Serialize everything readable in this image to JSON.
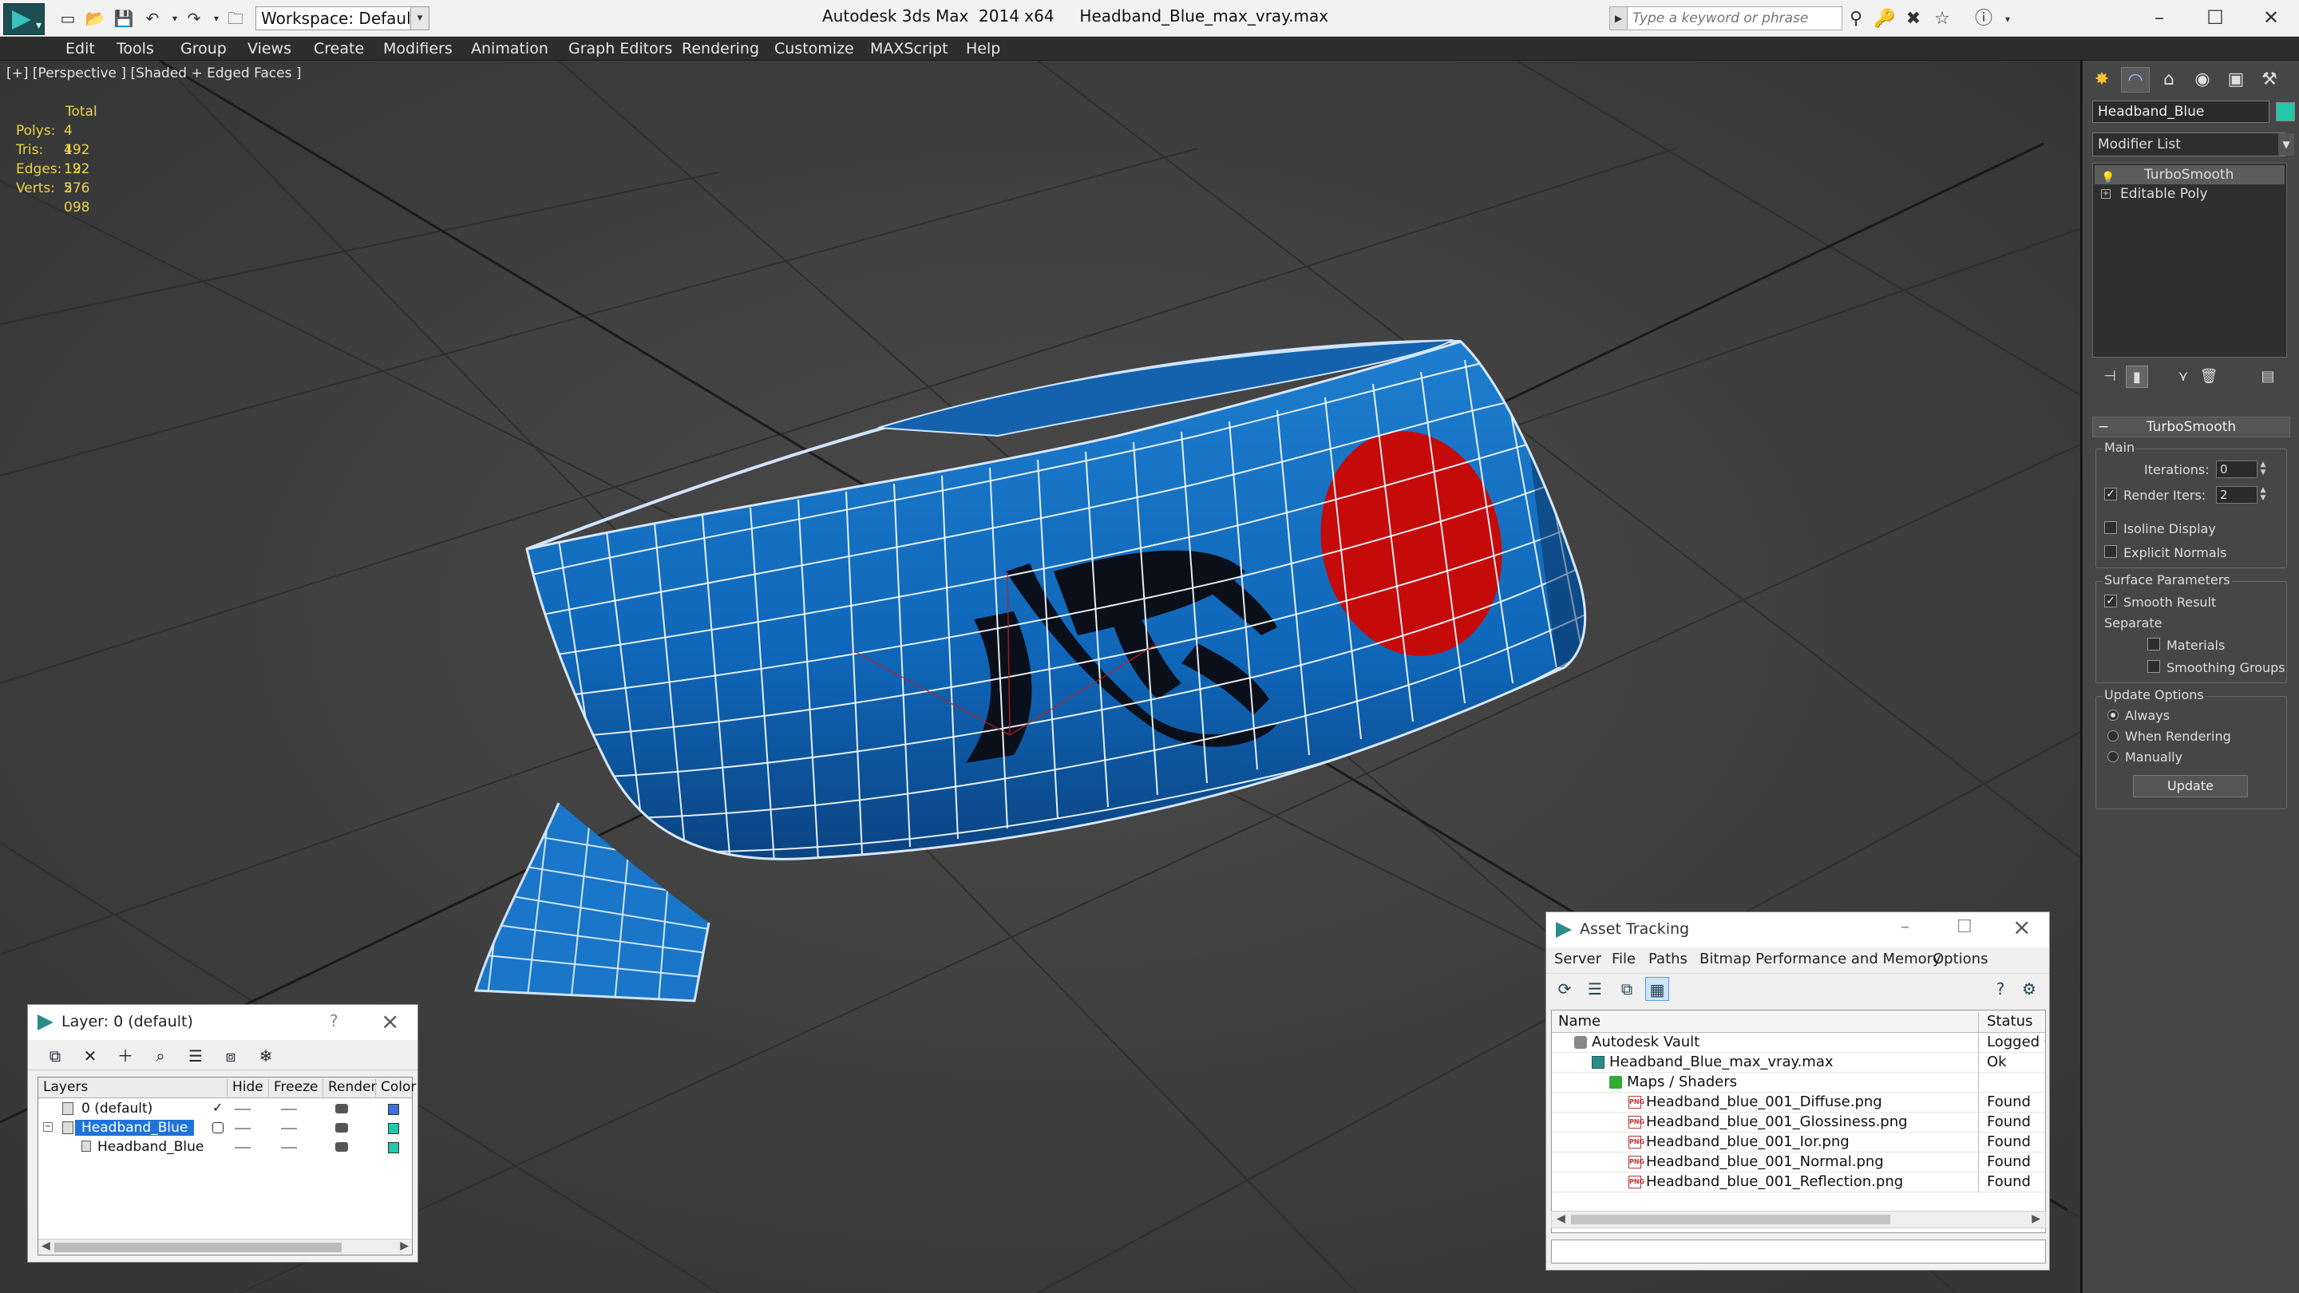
{
  "titlebar": {
    "workspace": "Workspace: Default",
    "app_name": "Autodesk 3ds Max  2014 x64",
    "file_name": "Headband_Blue_max_vray.max",
    "search_placeholder": "Type a keyword or phrase"
  },
  "menu": [
    "Edit",
    "Tools",
    "Group",
    "Views",
    "Create",
    "Modifiers",
    "Animation",
    "Graph Editors",
    "Rendering",
    "Customize",
    "MAXScript",
    "Help"
  ],
  "viewport": {
    "label": "[+] [Perspective ] [Shaded + Edged Faces ]",
    "stats": {
      "header": "Total",
      "rows": [
        {
          "key": "Polys:",
          "value": "4 192"
        },
        {
          "key": "Tris:",
          "value": "4 192"
        },
        {
          "key": "Edges:",
          "value": "12 576"
        },
        {
          "key": "Verts:",
          "value": "2 098"
        }
      ]
    }
  },
  "layer_dialog": {
    "title": "Layer: 0 (default)",
    "help": "?",
    "columns": [
      "Layers",
      "Hide",
      "Freeze",
      "Render",
      "Color"
    ],
    "rows": [
      {
        "name": "0 (default)",
        "color": "#3a6fd8"
      },
      {
        "name": "Headband_Blue",
        "color": "#22c8a8"
      },
      {
        "name": "Headband_Blue",
        "color": "#22c8a8"
      }
    ]
  },
  "asset_dialog": {
    "title": "Asset Tracking",
    "menu": [
      "Server",
      "File",
      "Paths",
      "Bitmap Performance and Memory",
      "Options"
    ],
    "columns": [
      "Name",
      "Status"
    ],
    "rows": [
      {
        "name": "Autodesk Vault",
        "status": "Logged Ou"
      },
      {
        "name": "Headband_Blue_max_vray.max",
        "status": "Ok"
      },
      {
        "name": "Maps / Shaders",
        "status": ""
      },
      {
        "name": "Headband_blue_001_Diffuse.png",
        "status": "Found"
      },
      {
        "name": "Headband_blue_001_Glossiness.png",
        "status": "Found"
      },
      {
        "name": "Headband_blue_001_Ior.png",
        "status": "Found"
      },
      {
        "name": "Headband_blue_001_Normal.png",
        "status": "Found"
      },
      {
        "name": "Headband_blue_001_Reflection.png",
        "status": "Found"
      }
    ]
  },
  "command_panel": {
    "object_name": "Headband_Blue",
    "object_color": "#22c8a8",
    "modifier_list": "Modifier List",
    "stack": [
      "TurboSmooth",
      "Editable Poly"
    ],
    "turbosmooth": {
      "title": "TurboSmooth",
      "main_label": "Main",
      "iterations_label": "Iterations:",
      "iterations_value": "0",
      "render_iters_label": "Render Iters:",
      "render_iters_value": "2",
      "render_iters_checked": true,
      "isoline_label": "Isoline Display",
      "explicit_label": "Explicit Normals",
      "surface_label": "Surface Parameters",
      "smooth_result_label": "Smooth Result",
      "separate_label": "Separate",
      "materials_label": "Materials",
      "smoothing_groups_label": "Smoothing Groups",
      "update_options_label": "Update Options",
      "always_label": "Always",
      "when_rendering_label": "When Rendering",
      "manually_label": "Manually",
      "update_button": "Update"
    }
  }
}
